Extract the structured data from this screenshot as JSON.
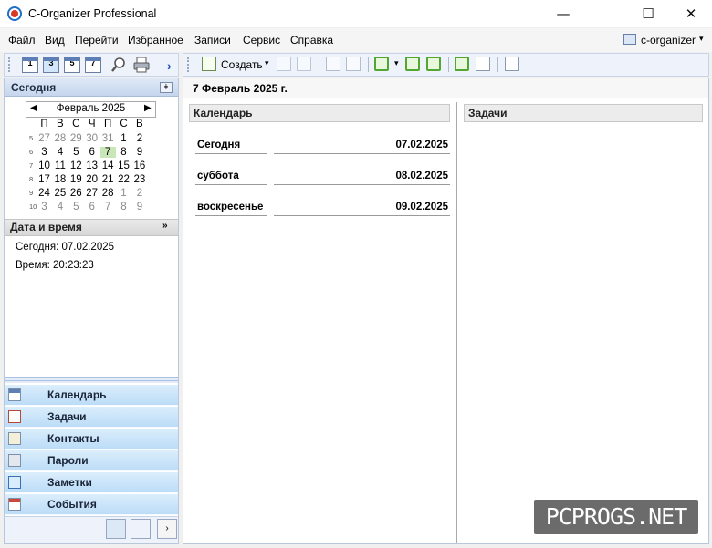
{
  "window": {
    "title": "C-Organizer Professional",
    "min_glyph": "—",
    "max_glyph": "☐",
    "close_glyph": "✕"
  },
  "menu": {
    "items": [
      {
        "label": "Файл"
      },
      {
        "label": "Вид"
      },
      {
        "label": "Перейти"
      },
      {
        "label": "Избранное"
      },
      {
        "label": "Записи"
      },
      {
        "label": "Сервис"
      },
      {
        "label": "Справка"
      }
    ],
    "profile": {
      "label": "c-organizer",
      "arrow": "▾"
    }
  },
  "left_toolbar": {
    "buttons": [
      "1",
      "3",
      "5",
      "7"
    ],
    "more": "›"
  },
  "today_panel": {
    "title": "Сегодня",
    "pin": "ǂ",
    "calendar": {
      "month": "Февраль 2025",
      "prev": "◀",
      "next": "▶",
      "weekdays": [
        "П",
        "В",
        "С",
        "Ч",
        "П",
        "С",
        "В"
      ],
      "week_numbers": [
        "5",
        "6",
        "7",
        "8",
        "9",
        "10"
      ],
      "weeks": [
        [
          "27",
          "28",
          "29",
          "30",
          "31",
          "1",
          "2"
        ],
        [
          "3",
          "4",
          "5",
          "6",
          "7",
          "8",
          "9"
        ],
        [
          "10",
          "11",
          "12",
          "13",
          "14",
          "15",
          "16"
        ],
        [
          "17",
          "18",
          "19",
          "20",
          "21",
          "22",
          "23"
        ],
        [
          "24",
          "25",
          "26",
          "27",
          "28",
          "1",
          "2"
        ],
        [
          "3",
          "4",
          "5",
          "6",
          "7",
          "8",
          "9"
        ]
      ],
      "selected_day": "7"
    }
  },
  "datetime_panel": {
    "title": "Дата и время",
    "collapse": "»",
    "today": "Сегодня: 07.02.2025",
    "time": "Время: 20:23:23"
  },
  "nav": {
    "items": [
      {
        "label": "Календарь",
        "icon": "calendar-icon"
      },
      {
        "label": "Задачи",
        "icon": "tasks-icon"
      },
      {
        "label": "Контакты",
        "icon": "contacts-icon"
      },
      {
        "label": "Пароли",
        "icon": "passwords-icon"
      },
      {
        "label": "Заметки",
        "icon": "notes-icon"
      },
      {
        "label": "События",
        "icon": "events-icon"
      }
    ],
    "more": "›"
  },
  "main_toolbar": {
    "create_label": "Создать",
    "create_arrow": "▾"
  },
  "main": {
    "date_title": "7 Февраль 2025 г.",
    "calendar_column": "Календарь",
    "tasks_column": "Задачи",
    "days": [
      {
        "name": "Сегодня",
        "date": "07.02.2025"
      },
      {
        "name": "суббота",
        "date": "08.02.2025"
      },
      {
        "name": "воскресенье",
        "date": "09.02.2025"
      }
    ]
  },
  "watermark": "PCPROGS.NET"
}
